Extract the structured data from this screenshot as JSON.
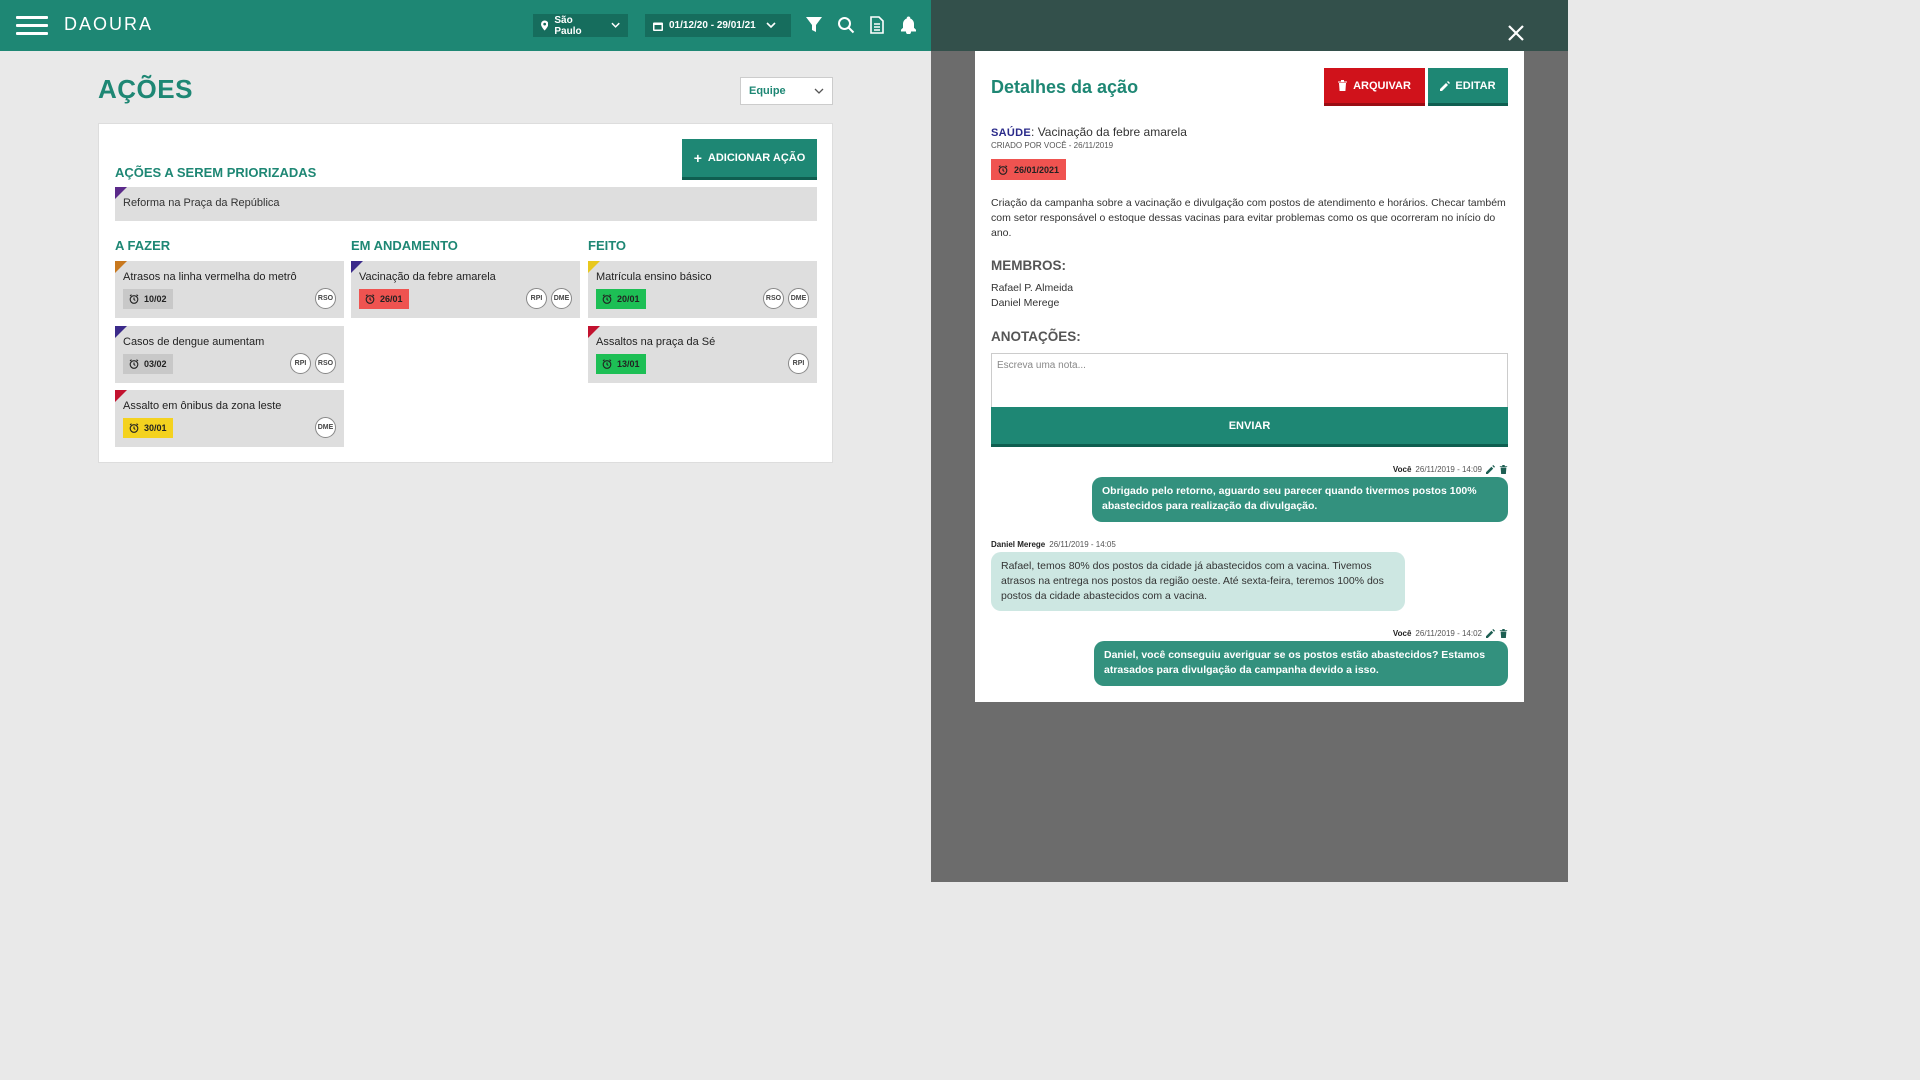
{
  "header": {
    "logo": "DAOURA",
    "location": "São Paulo",
    "date_range": "01/12/20 - 29/01/21"
  },
  "page": {
    "title": "AÇÕES",
    "filter_select": "Equipe",
    "add_button": "ADICIONAR AÇÃO",
    "priority_title": "AÇÕES A SEREM PRIORIZADAS",
    "priority_item": "Reforma na Praça da República"
  },
  "columns": [
    {
      "title": "A FAZER",
      "cards": [
        {
          "title": "Atrasos na linha vermelha do metrô",
          "date": "10/02",
          "members": [
            "RSO"
          ],
          "tag_color": "#c8781e",
          "date_color": "#c8c8c8"
        },
        {
          "title": "Casos de dengue aumentam",
          "date": "03/02",
          "members": [
            "RPI",
            "RSO"
          ],
          "tag_color": "#3b2a8a",
          "date_color": "#c8c8c8"
        },
        {
          "title": "Assalto em ônibus da zona leste",
          "date": "30/01",
          "members": [
            "DME"
          ],
          "tag_color": "#c2122f",
          "date_color": "#f4d21f"
        }
      ]
    },
    {
      "title": "EM ANDAMENTO",
      "cards": [
        {
          "title": "Vacinação da febre amarela",
          "date": "26/01",
          "members": [
            "RPI",
            "DME"
          ],
          "tag_color": "#3b2a8a",
          "date_color": "#ef5350"
        }
      ]
    },
    {
      "title": "FEITO",
      "cards": [
        {
          "title": "Matrícula ensino básico",
          "date": "20/01",
          "members": [
            "RSO",
            "DME"
          ],
          "tag_color": "#e8c81e",
          "date_color": "#1dbf55"
        },
        {
          "title": "Assaltos na praça da Sé",
          "date": "13/01",
          "members": [
            "RPI"
          ],
          "tag_color": "#c2122f",
          "date_color": "#1dbf55"
        }
      ]
    }
  ],
  "modal": {
    "title": "Detalhes da ação",
    "archive_button": "ARQUIVAR",
    "edit_button": "EDITAR",
    "category": "SAÚDE",
    "action_name": "Vacinação da febre amarela",
    "created": "CRIADO POR VOCÊ - 26/11/2019",
    "due": "26/01/2021",
    "description": "Criação da campanha sobre a vacinação e divulgação com postos de atendimento e horários. Checar também com setor responsável o estoque dessas vacinas para evitar problemas como os que ocorreram no início do ano.",
    "members_title": "MEMBROS:",
    "members": [
      "Rafael P. Almeida",
      "Daniel Merege"
    ],
    "notes_title": "ANOTAÇÕES:",
    "note_placeholder": "Escreva uma nota...",
    "send_button": "ENVIAR",
    "messages": [
      {
        "author": "Você",
        "time": "26/11/2019 - 14:09",
        "text": "Obrigado pelo retorno, aguardo seu parecer quando tivermos postos 100% abastecidos para realização da divulgação.",
        "mine": true
      },
      {
        "author": "Daniel Merege",
        "time": "26/11/2019 - 14:05",
        "text": "Rafael, temos 80% dos postos da cidade já abastecidos com a vacina. Tivemos atrasos na entrega nos postos da região oeste. Até sexta-feira, teremos 100% dos postos da cidade abastecidos com a vacina.",
        "mine": false
      },
      {
        "author": "Você",
        "time": "26/11/2019 - 14:02",
        "text": "Daniel, você conseguiu averiguar se os postos estão abastecidos? Estamos atrasados para divulgação da campanha devido a isso.",
        "mine": true
      }
    ]
  },
  "colors": {
    "brand": "#1e8774",
    "danger": "#d0121b"
  }
}
